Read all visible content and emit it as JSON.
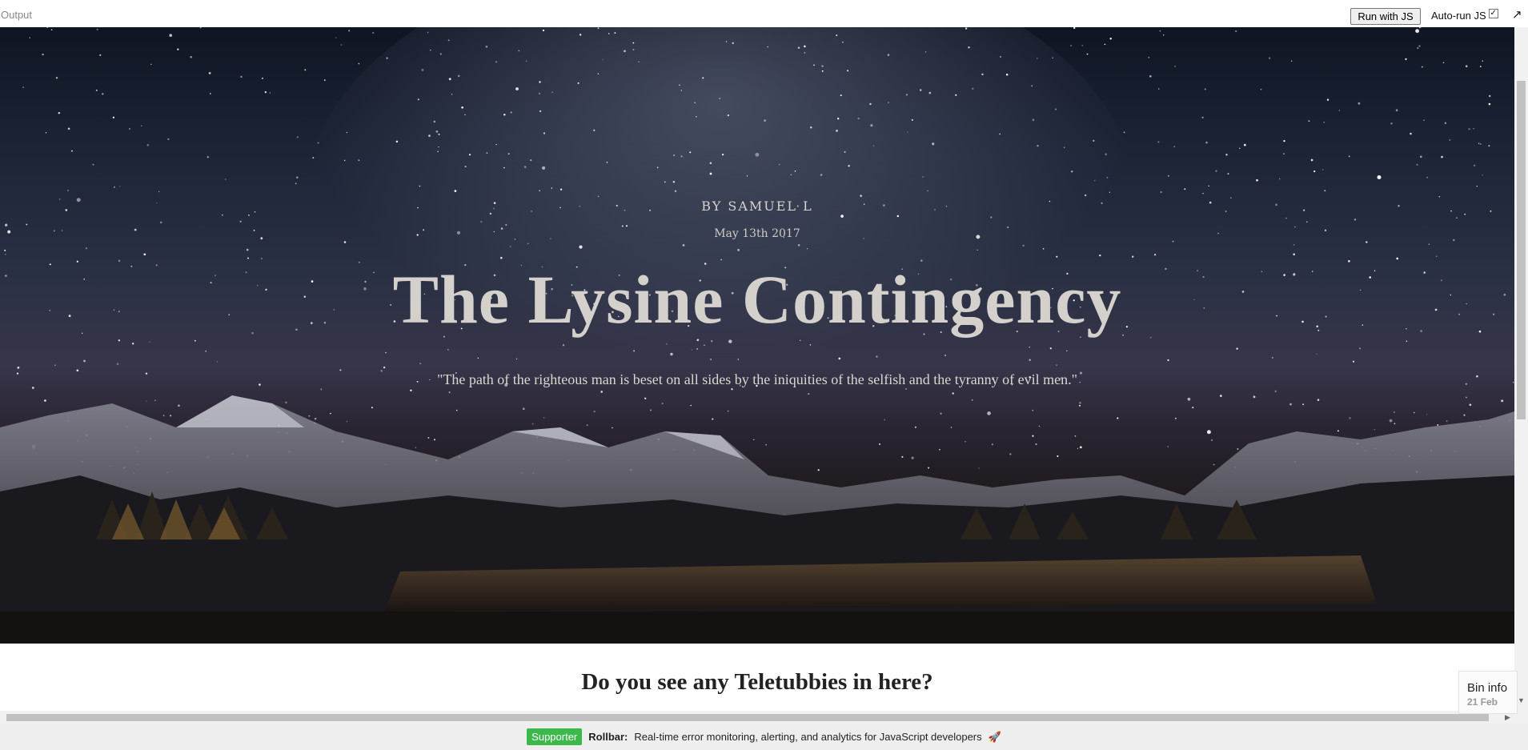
{
  "topbar": {
    "output_label": "Output",
    "run_button": "Run with JS",
    "autorun_label": "Auto-run JS",
    "autorun_checked": true,
    "popout_icon": "arrow-up-right"
  },
  "hero": {
    "byline": "BY SAMUEL L",
    "date": "May 13th 2017",
    "title": "The Lysine Contingency",
    "quote": "\"The path of the righteous man is beset on all sides by the iniquities of the selfish and the tyranny of evil men.\""
  },
  "content": {
    "heading": "Do you see any Teletubbies in here?"
  },
  "bin_info": {
    "title": "Bin info",
    "date": "21 Feb"
  },
  "ad": {
    "badge": "Supporter",
    "brand": "Rollbar:",
    "text": "Real-time error monitoring, alerting, and analytics for JavaScript developers",
    "icon": "rocket-icon"
  }
}
